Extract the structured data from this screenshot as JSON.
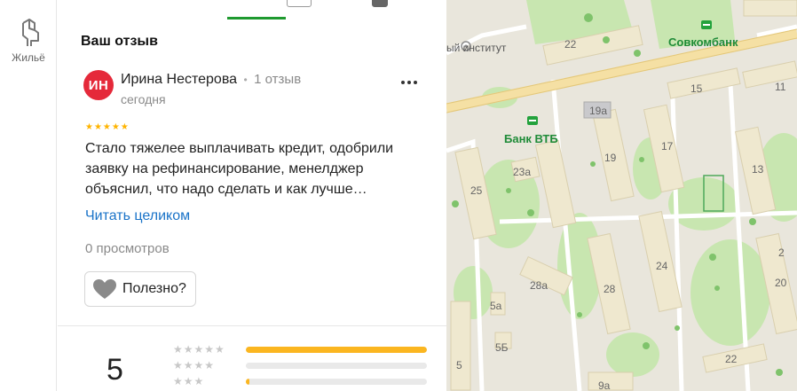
{
  "rail": {
    "items": [
      {
        "label": "Жильё",
        "icon": "housing-icon"
      }
    ]
  },
  "section": {
    "title": "Ваш отзыв"
  },
  "review": {
    "avatar_initials": "ИН",
    "avatar_color": "#e5293a",
    "author": "Ирина Нестерова",
    "separator": "•",
    "author_reviews": "1 отзыв",
    "date": "сегодня",
    "rating": 5,
    "stars": "★★★★★",
    "text": "Стало тяжелее выплачивать кредит, одобрили заявку на рефинансирование, менелджер объяснил, что надо сделать и как лучше…",
    "read_more": "Читать целиком",
    "views": "0 просмотров",
    "helpful_label": "Полезно?"
  },
  "rating_summary": {
    "value": "5",
    "rows": [
      {
        "stars": "★★★★★",
        "fill": 1.0
      },
      {
        "stars": "★★★★",
        "fill": 0.0
      },
      {
        "stars": "★★★",
        "fill": 0.02
      }
    ],
    "bar_color": "#fbb620"
  },
  "map": {
    "labels": {
      "institute": "ый институт",
      "sovcombank": "Совкомбанк",
      "vtb": "Банк ВТБ",
      "n22_top": "22",
      "n15": "15",
      "n11": "11",
      "n19a": "19а",
      "n17": "17",
      "n19": "19",
      "n23a": "23а",
      "n13": "13",
      "n25": "25",
      "n24": "24",
      "n2": "2",
      "n28a": "28а",
      "n28": "28",
      "n20": "20",
      "n5a": "5а",
      "n5b": "5Б",
      "n22_bottom": "22",
      "n5": "5",
      "n9a": "9а"
    }
  }
}
